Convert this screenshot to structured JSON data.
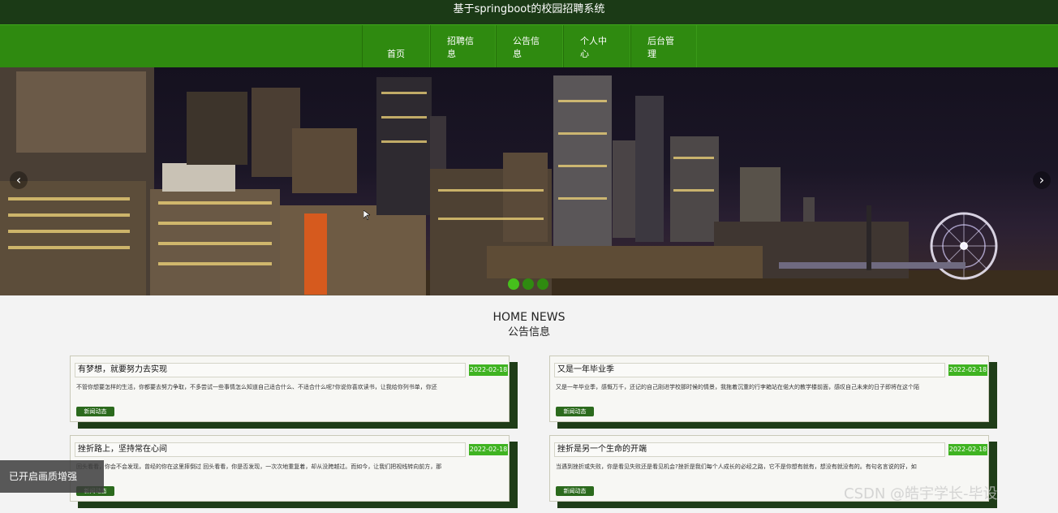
{
  "header": {
    "title": "基于springboot的校园招聘系统"
  },
  "nav": {
    "items": [
      {
        "label": "首页"
      },
      {
        "label": "招聘信息"
      },
      {
        "label": "公告信息"
      },
      {
        "label": "个人中心"
      },
      {
        "label": "后台管理"
      }
    ]
  },
  "banner": {
    "prev": "‹",
    "next": "›",
    "slide_count": 3,
    "active_slide": 1
  },
  "news": {
    "heading_en": "HOME NEWS",
    "heading_cn": "公告信息",
    "cards": [
      {
        "title": "有梦想，就要努力去实现",
        "date": "2022-02-18",
        "excerpt": "不管你想要怎样的生活，你都要去努力争取，不多尝试一些事情怎么知道自己适合什么、不适合什么呢?你说你喜欢读书，让我给你列书单，你还",
        "tag": "新闻动态"
      },
      {
        "title": "又是一年毕业季",
        "date": "2022-02-18",
        "excerpt": "又是一年毕业季，感慨万千，还记的自己刚进学校那时候的情景，我拖着沉重的行李箱站在偌大的教学楼前面，感叹自己未来的日子即将在这个陌",
        "tag": "新闻动态"
      },
      {
        "title": "挫折路上，坚持常在心间",
        "date": "2022-02-18",
        "excerpt": "回头看看，你会不会发现，曾经的你在这里摔倒过 回头看看，你是否发现，一次次地重复着，却从没跨越过。而如今，让我们把视线转向前方，那",
        "tag": "新闻动态"
      },
      {
        "title": "挫折是另一个生命的开端",
        "date": "2022-02-18",
        "excerpt": "当遇到挫折或失败，你是看见失败还是看见机会?挫折是我们每个人成长的必经之路，它不是你想有就有，想没有就没有的。有句名言说的好，如",
        "tag": "新闻动态"
      }
    ]
  },
  "overlay": {
    "toast": "已开启画质增强",
    "watermark": "CSDN @皓宇学长-毕设"
  },
  "colors": {
    "header_bg": "#1b3a16",
    "nav_bg": "#2f8a10",
    "accent": "#3fb321",
    "tag_bg": "#2b6a1d"
  }
}
